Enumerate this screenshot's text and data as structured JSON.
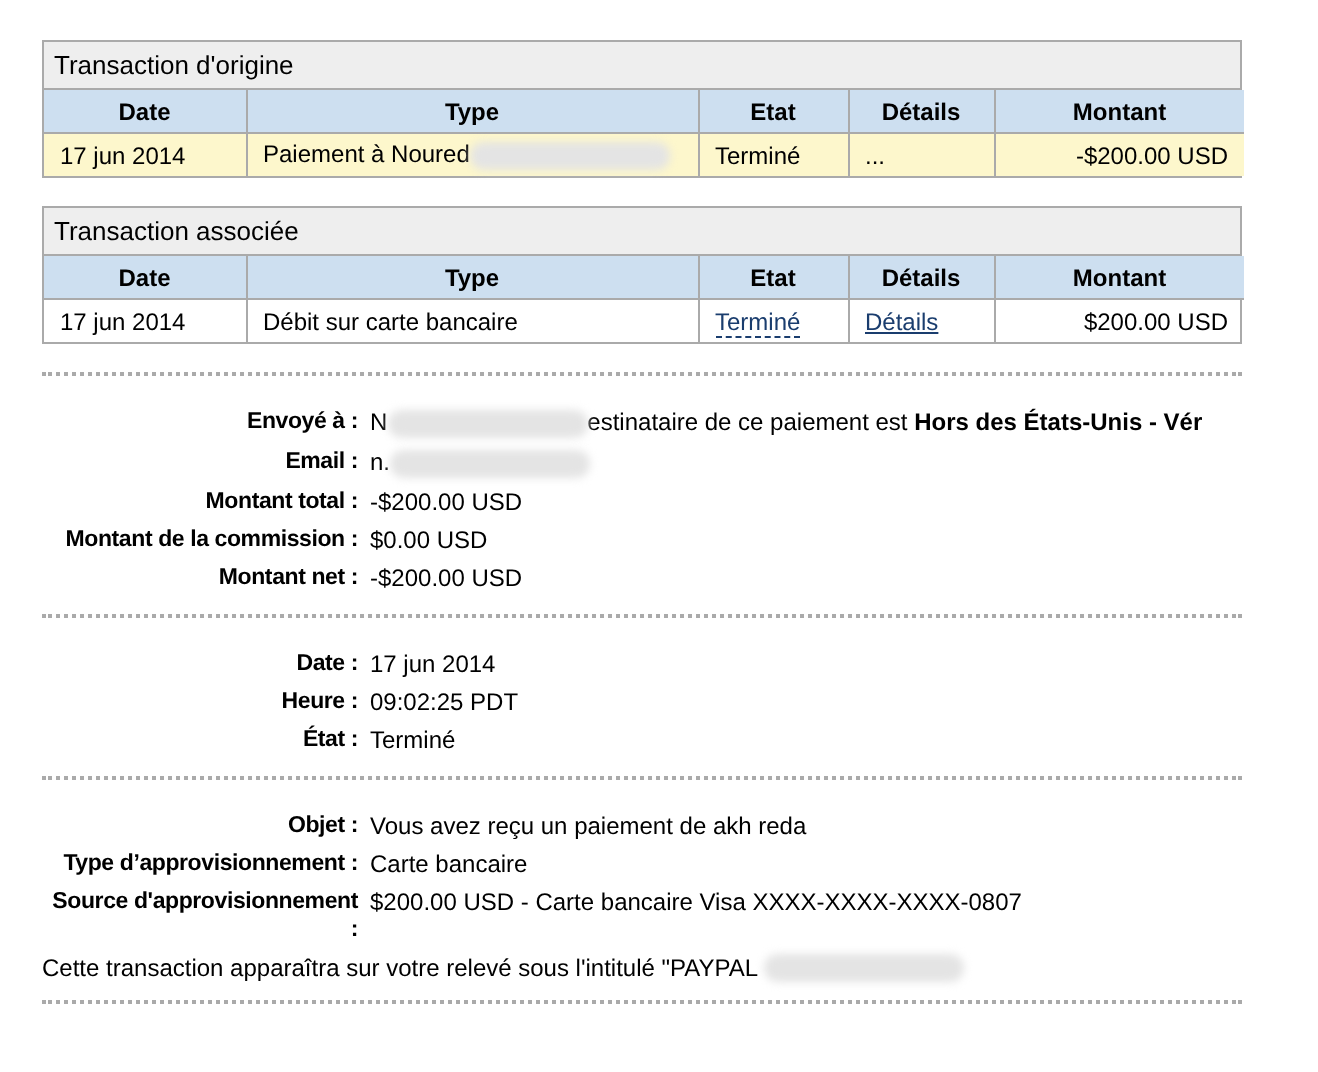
{
  "tables": [
    {
      "title": "Transaction d'origine",
      "columns": [
        "Date",
        "Type",
        "Etat",
        "Détails",
        "Montant"
      ],
      "rows": [
        {
          "highlighted": true,
          "cells": [
            {
              "kind": "text",
              "text": "17 jun 2014"
            },
            {
              "kind": "text",
              "text": "Paiement à Noured",
              "redacted": true
            },
            {
              "kind": "text",
              "text": "Terminé"
            },
            {
              "kind": "text",
              "text": "..."
            },
            {
              "kind": "amount",
              "text": "-$200.00 USD"
            }
          ]
        }
      ]
    },
    {
      "title": "Transaction associée",
      "columns": [
        "Date",
        "Type",
        "Etat",
        "Détails",
        "Montant"
      ],
      "rows": [
        {
          "highlighted": false,
          "cells": [
            {
              "kind": "text",
              "text": "17 jun 2014"
            },
            {
              "kind": "text",
              "text": "Débit sur carte bancaire"
            },
            {
              "kind": "hint",
              "text": "Terminé"
            },
            {
              "kind": "link",
              "text": "Détails"
            },
            {
              "kind": "amount",
              "text": "$200.00 USD"
            }
          ]
        }
      ]
    }
  ],
  "sections": [
    {
      "fields": [
        {
          "kind": "field",
          "label": "Envoyé à :",
          "value": "N",
          "redacted": true,
          "value_after": "estinataire de ce paiement est **Hors des États-Unis - Vér**"
        },
        {
          "kind": "field",
          "label": "Email :",
          "value": "n.",
          "redacted": true
        },
        {
          "kind": "field",
          "label": "Montant total :",
          "value": "-$200.00 USD"
        },
        {
          "kind": "field",
          "label": "Montant de la commission :",
          "value": "$0.00 USD"
        },
        {
          "kind": "field",
          "label": "Montant net :",
          "value": "-$200.00 USD"
        }
      ]
    },
    {
      "fields": [
        {
          "kind": "field",
          "label": "Date :",
          "value": "17 jun 2014"
        },
        {
          "kind": "field",
          "label": "Heure :",
          "value": "09:02:25 PDT"
        },
        {
          "kind": "field",
          "label": "État :",
          "value": "Terminé"
        }
      ]
    },
    {
      "fields": [
        {
          "kind": "field",
          "label": "Objet :",
          "value": "Vous avez reçu un paiement de akh reda"
        },
        {
          "kind": "field",
          "label": "Type d’approvisionnement :",
          "value": "Carte bancaire"
        },
        {
          "kind": "field",
          "label": "Source d'approvisionnement :",
          "value": "$200.00 USD - Carte bancaire Visa XXXX-XXXX-XXXX-0807"
        },
        {
          "kind": "note",
          "value": "Cette transaction apparaîtra sur votre relevé sous l'intitulé \"PAYPAL",
          "redacted": true
        }
      ]
    }
  ]
}
